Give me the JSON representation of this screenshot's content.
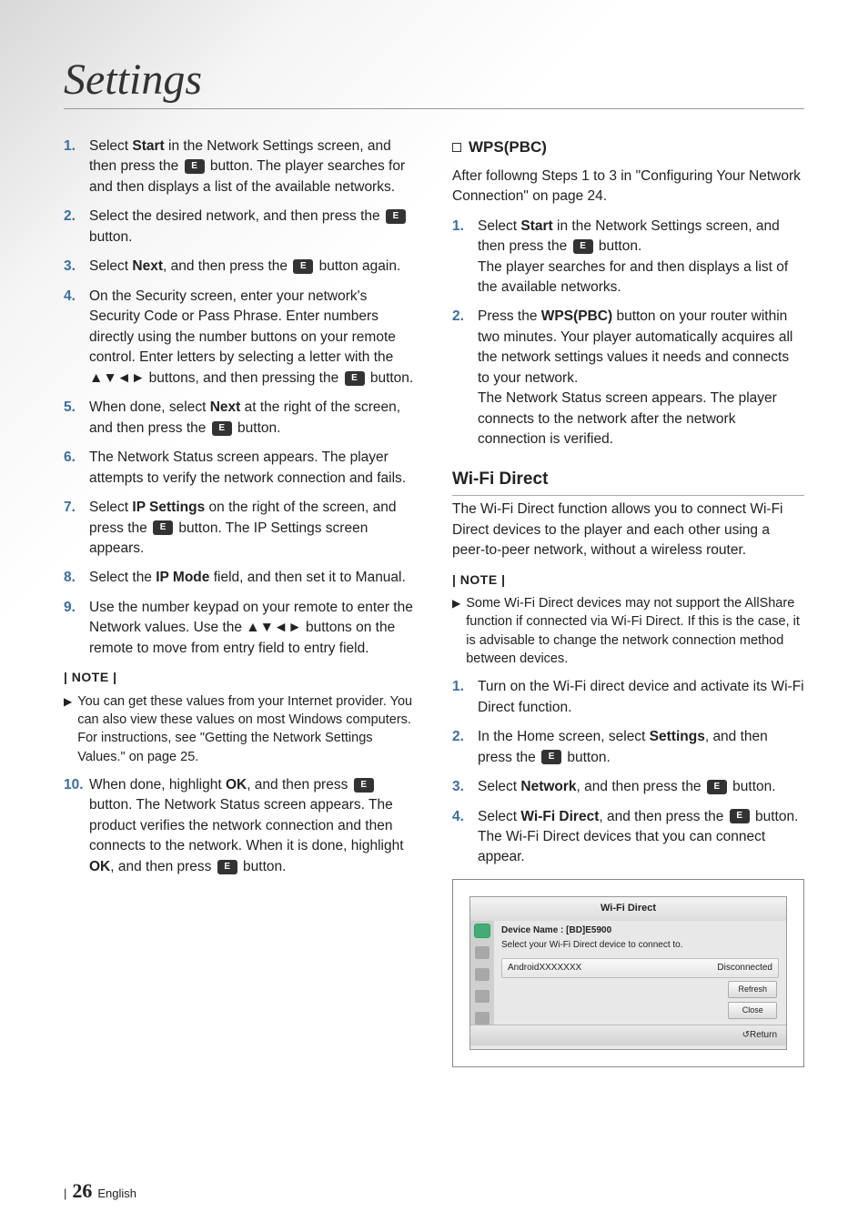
{
  "title": "Settings",
  "left": {
    "steps": [
      {
        "n": "1.",
        "html": "Select <b>Start</b> in the Network Settings screen, and then press the [E] button. The player searches for and then displays a list of the available networks."
      },
      {
        "n": "2.",
        "html": "Select the desired network, and then press the [E] button."
      },
      {
        "n": "3.",
        "html": "Select <b>Next</b>, and then press the [E] button again."
      },
      {
        "n": "4.",
        "html": "On the Security screen, enter your network's Security Code or Pass Phrase. Enter numbers directly using the number buttons on your remote control. Enter letters by selecting a letter with the ▲▼◄► buttons, and then pressing the [E] button."
      },
      {
        "n": "5.",
        "html": "When done, select <b>Next</b> at the right of the screen, and then press the [E] button."
      },
      {
        "n": "6.",
        "html": "The Network Status screen appears. The player attempts to verify the network connection and fails."
      },
      {
        "n": "7.",
        "html": "Select <b>IP Settings</b> on the right of the screen, and press the [E] button. The IP Settings screen appears."
      },
      {
        "n": "8.",
        "html": "Select the <b>IP Mode</b> field, and then set it to Manual."
      },
      {
        "n": "9.",
        "html": "Use the number keypad on your remote to enter the Network values. Use the ▲▼◄► buttons on the remote to move from entry field to entry field."
      }
    ],
    "note_label": "| NOTE |",
    "note": "You can get these values from your Internet provider. You can also view these values on most Windows computers. For instructions, see \"Getting the Network Settings Values.\" on page 25.",
    "step10": {
      "n": "10.",
      "html": "When done, highlight <b>OK</b>, and then press [E] button. The Network Status screen appears. The product verifies the network connection and then connects to the network. When it is done, highlight <b>OK</b>, and then press [E] button."
    }
  },
  "right": {
    "wps_heading": "WPS(PBC)",
    "wps_intro": "After followng Steps 1 to 3 in \"Configuring Your Network Connection\" on page 24.",
    "wps_steps": [
      {
        "n": "1.",
        "html": "Select <b>Start</b> in the Network Settings screen, and then press the [E] button.<br>The player searches for and then displays a list of the available networks."
      },
      {
        "n": "2.",
        "html": "Press the <b>WPS(PBC)</b> button on your router within two minutes. Your player automatically acquires all the network settings values it needs and connects to your network.<br>The Network Status screen appears. The player connects to the network after the network connection is verified."
      }
    ],
    "wifi_heading": "Wi-Fi Direct",
    "wifi_intro": "The Wi-Fi Direct function allows you to connect Wi-Fi Direct devices to the player and each other using a peer-to-peer network, without a wireless router.",
    "note_label": "| NOTE |",
    "wifi_note": "Some Wi-Fi Direct devices may not support the AllShare function if connected via Wi-Fi Direct. If this is the case, it is advisable to change the network connection method between devices.",
    "wifi_steps": [
      {
        "n": "1.",
        "html": "Turn on the Wi-Fi direct device and activate its Wi-Fi Direct function."
      },
      {
        "n": "2.",
        "html": "In the Home screen, select <b>Settings</b>, and then press the [E] button."
      },
      {
        "n": "3.",
        "html": "Select <b>Network</b>, and then press the [E] button."
      },
      {
        "n": "4.",
        "html": "Select <b>Wi-Fi Direct</b>, and then press the [E] button.<br>The Wi-Fi Direct devices that you can connect appear."
      }
    ],
    "dialog": {
      "title": "Wi-Fi Direct",
      "device_name": "Device Name : [BD]E5900",
      "instruction": "Select your Wi-Fi Direct device to connect to.",
      "item_name": "AndroidXXXXXXX",
      "item_status": "Disconnected",
      "btn_refresh": "Refresh",
      "btn_close": "Close",
      "return": "Return"
    }
  },
  "footer": {
    "page": "26",
    "lang": "English"
  }
}
